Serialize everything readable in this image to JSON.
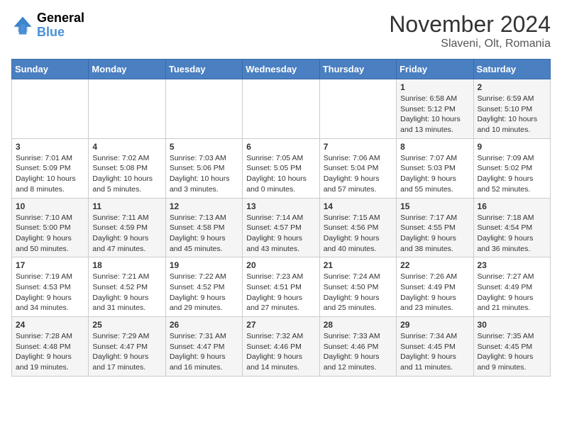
{
  "header": {
    "logo": {
      "text_general": "General",
      "text_blue": "Blue"
    },
    "title": "November 2024",
    "location": "Slaveni, Olt, Romania"
  },
  "days_of_week": [
    "Sunday",
    "Monday",
    "Tuesday",
    "Wednesday",
    "Thursday",
    "Friday",
    "Saturday"
  ],
  "weeks": [
    [
      {
        "day": "",
        "info": ""
      },
      {
        "day": "",
        "info": ""
      },
      {
        "day": "",
        "info": ""
      },
      {
        "day": "",
        "info": ""
      },
      {
        "day": "",
        "info": ""
      },
      {
        "day": "1",
        "info": "Sunrise: 6:58 AM\nSunset: 5:12 PM\nDaylight: 10 hours and 13 minutes."
      },
      {
        "day": "2",
        "info": "Sunrise: 6:59 AM\nSunset: 5:10 PM\nDaylight: 10 hours and 10 minutes."
      }
    ],
    [
      {
        "day": "3",
        "info": "Sunrise: 7:01 AM\nSunset: 5:09 PM\nDaylight: 10 hours and 8 minutes."
      },
      {
        "day": "4",
        "info": "Sunrise: 7:02 AM\nSunset: 5:08 PM\nDaylight: 10 hours and 5 minutes."
      },
      {
        "day": "5",
        "info": "Sunrise: 7:03 AM\nSunset: 5:06 PM\nDaylight: 10 hours and 3 minutes."
      },
      {
        "day": "6",
        "info": "Sunrise: 7:05 AM\nSunset: 5:05 PM\nDaylight: 10 hours and 0 minutes."
      },
      {
        "day": "7",
        "info": "Sunrise: 7:06 AM\nSunset: 5:04 PM\nDaylight: 9 hours and 57 minutes."
      },
      {
        "day": "8",
        "info": "Sunrise: 7:07 AM\nSunset: 5:03 PM\nDaylight: 9 hours and 55 minutes."
      },
      {
        "day": "9",
        "info": "Sunrise: 7:09 AM\nSunset: 5:02 PM\nDaylight: 9 hours and 52 minutes."
      }
    ],
    [
      {
        "day": "10",
        "info": "Sunrise: 7:10 AM\nSunset: 5:00 PM\nDaylight: 9 hours and 50 minutes."
      },
      {
        "day": "11",
        "info": "Sunrise: 7:11 AM\nSunset: 4:59 PM\nDaylight: 9 hours and 47 minutes."
      },
      {
        "day": "12",
        "info": "Sunrise: 7:13 AM\nSunset: 4:58 PM\nDaylight: 9 hours and 45 minutes."
      },
      {
        "day": "13",
        "info": "Sunrise: 7:14 AM\nSunset: 4:57 PM\nDaylight: 9 hours and 43 minutes."
      },
      {
        "day": "14",
        "info": "Sunrise: 7:15 AM\nSunset: 4:56 PM\nDaylight: 9 hours and 40 minutes."
      },
      {
        "day": "15",
        "info": "Sunrise: 7:17 AM\nSunset: 4:55 PM\nDaylight: 9 hours and 38 minutes."
      },
      {
        "day": "16",
        "info": "Sunrise: 7:18 AM\nSunset: 4:54 PM\nDaylight: 9 hours and 36 minutes."
      }
    ],
    [
      {
        "day": "17",
        "info": "Sunrise: 7:19 AM\nSunset: 4:53 PM\nDaylight: 9 hours and 34 minutes."
      },
      {
        "day": "18",
        "info": "Sunrise: 7:21 AM\nSunset: 4:52 PM\nDaylight: 9 hours and 31 minutes."
      },
      {
        "day": "19",
        "info": "Sunrise: 7:22 AM\nSunset: 4:52 PM\nDaylight: 9 hours and 29 minutes."
      },
      {
        "day": "20",
        "info": "Sunrise: 7:23 AM\nSunset: 4:51 PM\nDaylight: 9 hours and 27 minutes."
      },
      {
        "day": "21",
        "info": "Sunrise: 7:24 AM\nSunset: 4:50 PM\nDaylight: 9 hours and 25 minutes."
      },
      {
        "day": "22",
        "info": "Sunrise: 7:26 AM\nSunset: 4:49 PM\nDaylight: 9 hours and 23 minutes."
      },
      {
        "day": "23",
        "info": "Sunrise: 7:27 AM\nSunset: 4:49 PM\nDaylight: 9 hours and 21 minutes."
      }
    ],
    [
      {
        "day": "24",
        "info": "Sunrise: 7:28 AM\nSunset: 4:48 PM\nDaylight: 9 hours and 19 minutes."
      },
      {
        "day": "25",
        "info": "Sunrise: 7:29 AM\nSunset: 4:47 PM\nDaylight: 9 hours and 17 minutes."
      },
      {
        "day": "26",
        "info": "Sunrise: 7:31 AM\nSunset: 4:47 PM\nDaylight: 9 hours and 16 minutes."
      },
      {
        "day": "27",
        "info": "Sunrise: 7:32 AM\nSunset: 4:46 PM\nDaylight: 9 hours and 14 minutes."
      },
      {
        "day": "28",
        "info": "Sunrise: 7:33 AM\nSunset: 4:46 PM\nDaylight: 9 hours and 12 minutes."
      },
      {
        "day": "29",
        "info": "Sunrise: 7:34 AM\nSunset: 4:45 PM\nDaylight: 9 hours and 11 minutes."
      },
      {
        "day": "30",
        "info": "Sunrise: 7:35 AM\nSunset: 4:45 PM\nDaylight: 9 hours and 9 minutes."
      }
    ]
  ]
}
